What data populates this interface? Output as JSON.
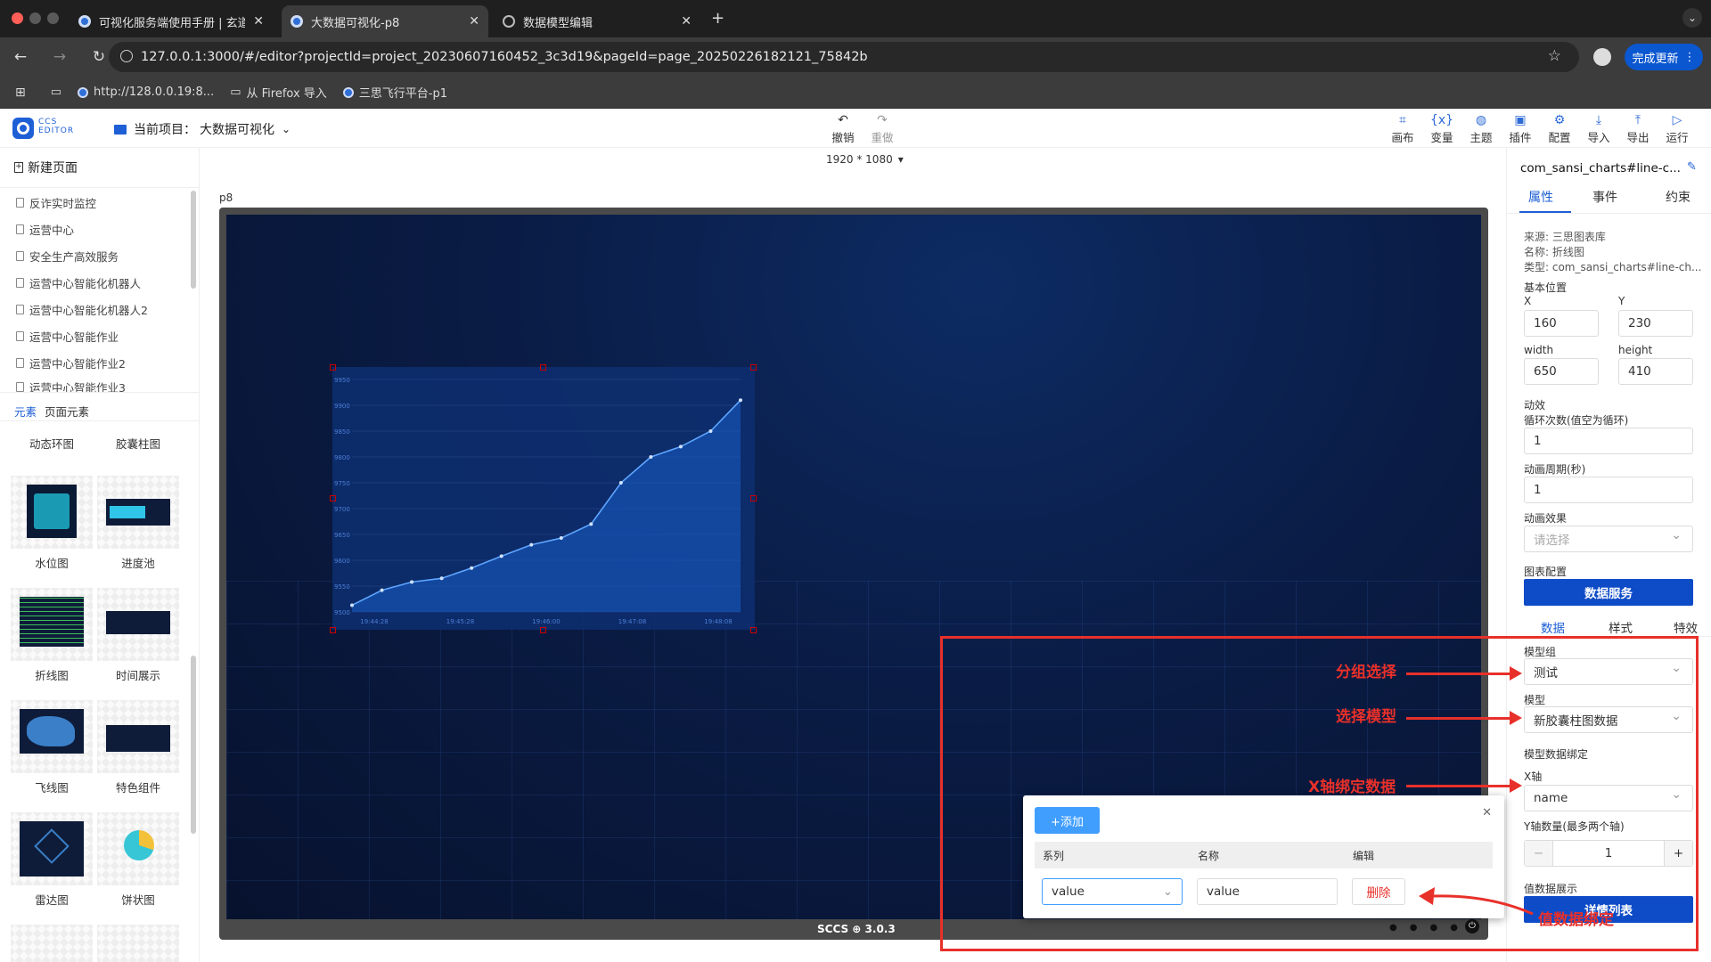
{
  "browser": {
    "tabs": [
      {
        "label": "可视化服务端使用手册 | 玄道智",
        "active": false
      },
      {
        "label": "大数据可视化-p8",
        "active": true
      },
      {
        "label": "数据模型编辑",
        "active": false
      }
    ],
    "url": "127.0.0.1:3000/#/editor?projectId=project_20230607160452_3c3d19&pageId=page_20250226182121_75842b",
    "update_button": "完成更新",
    "bookmarks": [
      "http://128.0.0.19:8...",
      "从 Firefox 导入",
      "三思飞行平台-p1"
    ]
  },
  "app": {
    "logo_line1": "CCS",
    "logo_line2": "EDITOR",
    "project_prefix": "当前项目：",
    "project_name": "大数据可视化",
    "undo": "撤销",
    "redo": "重做",
    "canvas_size": "1920 * 1080",
    "tools": [
      "画布",
      "变量",
      "主题",
      "插件",
      "配置",
      "导入",
      "导出",
      "运行"
    ]
  },
  "left": {
    "new_page": "新建页面",
    "pages": [
      "反诈实时监控",
      "运营中心",
      "安全生产高效服务",
      "运营中心智能化机器人",
      "运营中心智能化机器人2",
      "运营中心智能作业",
      "运营中心智能作业2",
      "运营中心智能作业3"
    ],
    "tabs": [
      "元素",
      "页面元素"
    ],
    "components": [
      [
        "动态环图",
        "胶囊柱图"
      ],
      [
        "水位图",
        "进度池"
      ],
      [
        "折线图",
        "时间展示"
      ],
      [
        "飞线图",
        "特色组件"
      ],
      [
        "雷达图",
        "饼状图"
      ]
    ]
  },
  "canvas": {
    "page_name": "p8",
    "footer": "SCCS ⊕ 3.0.3"
  },
  "chart_data": {
    "type": "area",
    "title": "",
    "x": [
      "19:44:28",
      "19:45:28",
      "19:46:00",
      "19:47:08",
      "19:48:08"
    ],
    "values": [
      9513,
      9542,
      9558,
      9565,
      9585,
      9608,
      9630,
      9643,
      9670,
      9750,
      9800,
      9820,
      9850,
      9910
    ],
    "y_ticks": [
      9500,
      9550,
      9600,
      9650,
      9700,
      9750,
      9800,
      9850,
      9900,
      9950
    ],
    "ylim": [
      9500,
      9950
    ],
    "fill_color": "#1a5fc8",
    "line_color": "#5ea5ff"
  },
  "right": {
    "component_title": "com_sansi_charts#line-c...",
    "tabs": [
      "属性",
      "事件",
      "约束"
    ],
    "source": "来源: 三思图表库",
    "name": "名称: 折线图",
    "type": "类型: com_sansi_charts#line-ch...",
    "basic_position": "基本位置",
    "x_label": "X",
    "x_value": "160",
    "y_label": "Y",
    "y_value": "230",
    "w_label": "width",
    "w_value": "650",
    "h_label": "height",
    "h_value": "410",
    "anim": "动效",
    "loop_label": "循环次数(值空为循环)",
    "loop_value": "1",
    "period_label": "动画周期(秒)",
    "period_value": "1",
    "effect_label": "动画效果",
    "effect_placeholder": "请选择",
    "chart_config": "图表配置",
    "data_service": "数据服务",
    "data_tabs": [
      "数据",
      "样式",
      "特效"
    ],
    "model_group_label": "模型组",
    "model_group_value": "测试",
    "model_label": "模型",
    "model_value": "新胶囊柱图数据",
    "binding_label": "模型数据绑定",
    "xaxis_label": "X轴",
    "xaxis_value": "name",
    "yaxis_count_label": "Y轴数量(最多两个轴)",
    "yaxis_count_value": "1",
    "value_display": "值数据展示",
    "detail_list": "详情列表"
  },
  "popup": {
    "add": "+添加",
    "headers": [
      "系列",
      "名称",
      "编辑"
    ],
    "series_value": "value",
    "name_value": "value",
    "delete": "删除"
  },
  "annotations": {
    "group": "分组选择",
    "model": "选择模型",
    "xaxis": "X轴绑定数据",
    "value": "值数据绑定",
    "color": "#e8302a"
  }
}
